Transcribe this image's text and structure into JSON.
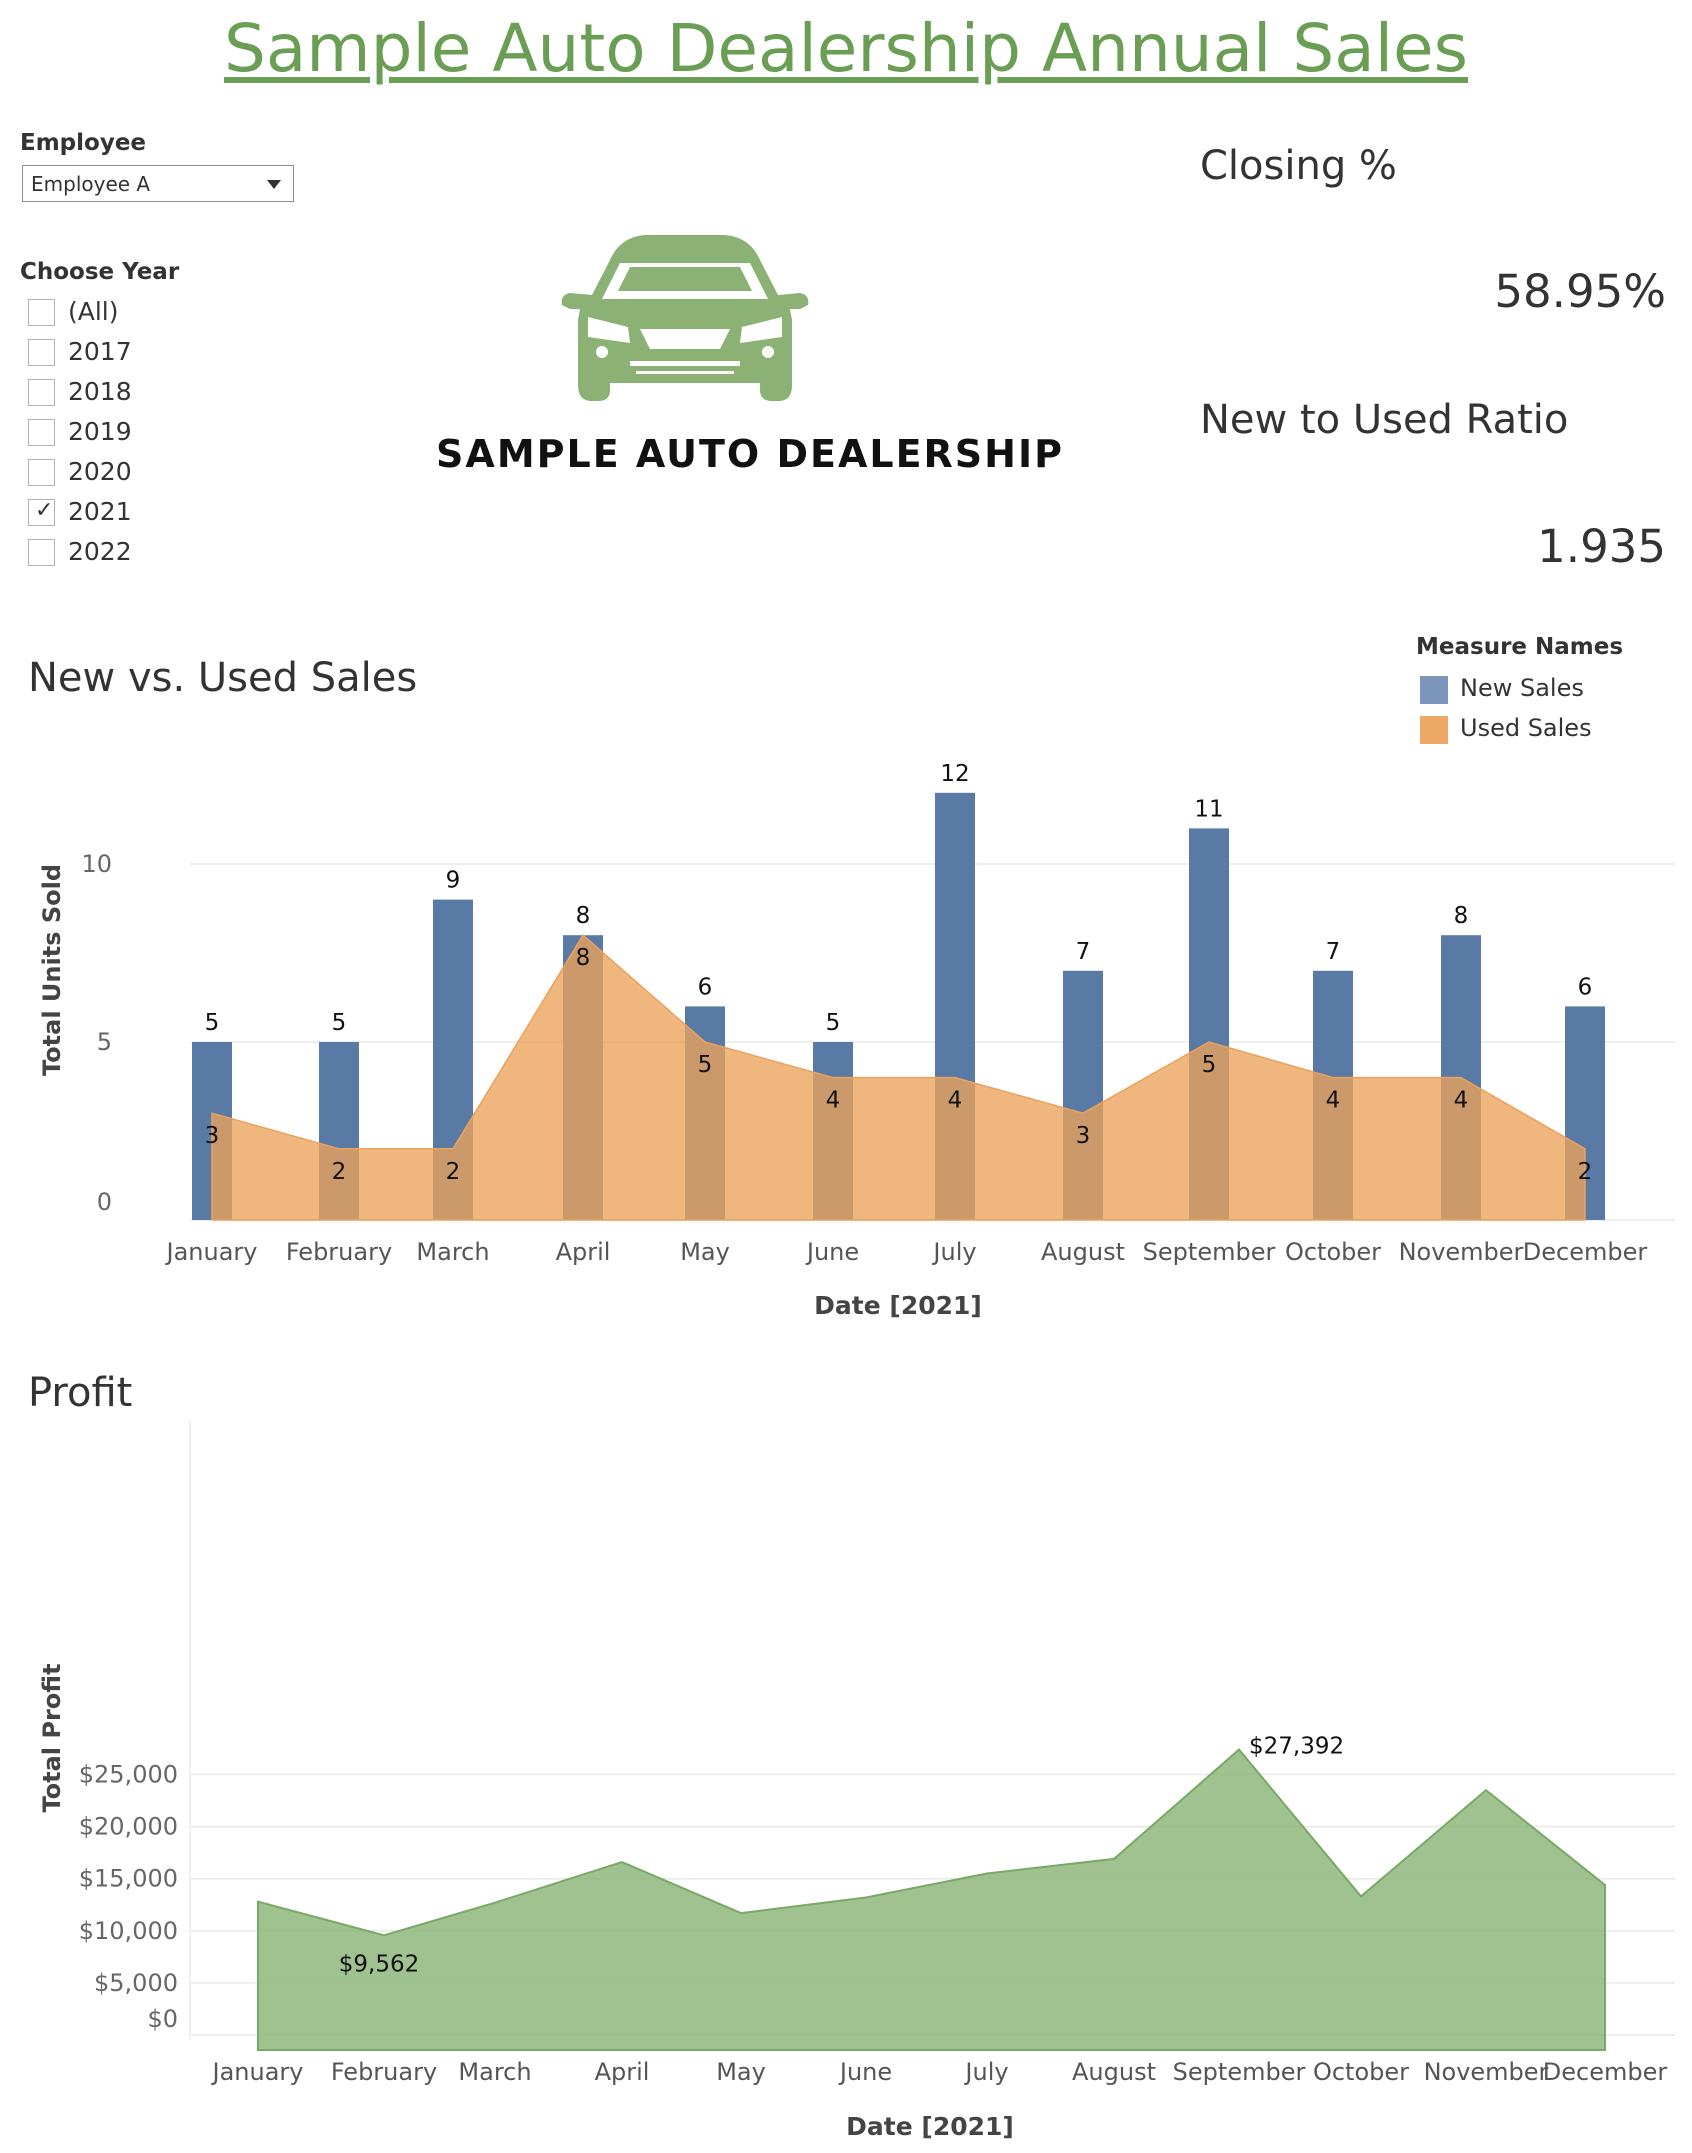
{
  "title": "Sample Auto Dealership Annual Sales",
  "filters": {
    "employee_label": "Employee",
    "employee_value": "Employee A",
    "year_label": "Choose Year",
    "years": [
      {
        "label": "(All)",
        "checked": false
      },
      {
        "label": "2017",
        "checked": false
      },
      {
        "label": "2018",
        "checked": false
      },
      {
        "label": "2019",
        "checked": false
      },
      {
        "label": "2020",
        "checked": false
      },
      {
        "label": "2021",
        "checked": true
      },
      {
        "label": "2022",
        "checked": false
      }
    ]
  },
  "logo": {
    "text": "SAMPLE AUTO DEALERSHIP",
    "icon": "car-front-icon",
    "color": "#8bb174"
  },
  "kpis": {
    "closing_title": "Closing %",
    "closing_value": "58.95%",
    "ratio_title": "New to Used Ratio",
    "ratio_value": "1.935"
  },
  "legend": {
    "title": "Measure Names",
    "items": [
      {
        "label": "New Sales",
        "color": "#7b96ba"
      },
      {
        "label": "Used Sales",
        "color": "#eda866"
      }
    ]
  },
  "colors": {
    "title": "#6a9e54",
    "new_bar": "#5a7aa6",
    "used_area": "#eba25a",
    "profit_area": "#8bb578"
  },
  "chart_data": [
    {
      "type": "bar",
      "title": "New vs. Used Sales",
      "xlabel": "Date [2021]",
      "ylabel": "Total Units Sold",
      "categories": [
        "January",
        "February",
        "March",
        "April",
        "May",
        "June",
        "July",
        "August",
        "September",
        "October",
        "November",
        "December"
      ],
      "series": [
        {
          "name": "New Sales",
          "type": "bar",
          "values": [
            5,
            5,
            9,
            8,
            6,
            5,
            12,
            7,
            11,
            7,
            8,
            6
          ]
        },
        {
          "name": "Used Sales",
          "type": "area",
          "values": [
            3,
            2,
            2,
            8,
            5,
            4,
            4,
            3,
            5,
            4,
            4,
            2
          ]
        }
      ],
      "yticks": [
        0,
        5,
        10
      ],
      "ylim": [
        0,
        13
      ],
      "grid": true
    },
    {
      "type": "area",
      "title": "Profit",
      "xlabel": "Date [2021]",
      "ylabel": "Total Profit",
      "categories": [
        "January",
        "February",
        "March",
        "April",
        "May",
        "June",
        "July",
        "August",
        "September",
        "October",
        "November",
        "December"
      ],
      "series": [
        {
          "values": [
            12800,
            9562,
            12700,
            16600,
            11700,
            13200,
            15500,
            16900,
            27392,
            13300,
            23500,
            14400
          ]
        }
      ],
      "annotations": [
        {
          "category": "February",
          "label": "$9,562"
        },
        {
          "category": "September",
          "label": "$27,392"
        }
      ],
      "yticks": [
        0,
        5000,
        10000,
        15000,
        20000,
        25000
      ],
      "ytick_labels": [
        "$0",
        "$5,000",
        "$10,000",
        "$15,000",
        "$20,000",
        "$25,000"
      ],
      "ylim": [
        0,
        28500
      ],
      "grid": true
    }
  ]
}
